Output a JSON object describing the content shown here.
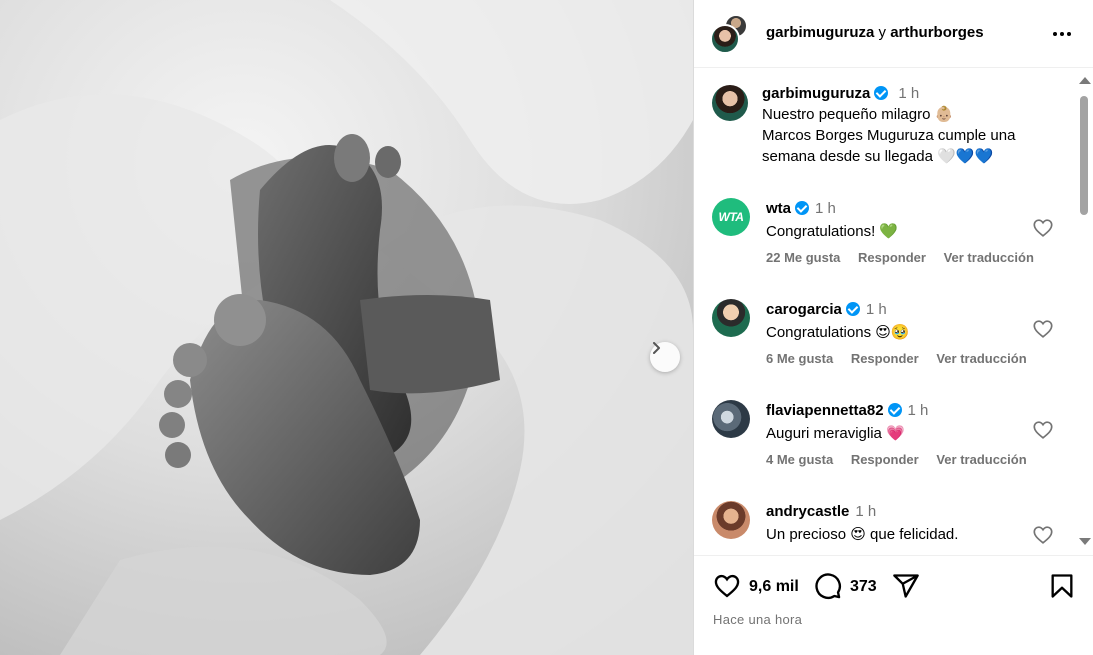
{
  "post": {
    "header": {
      "author": "garbimuguruza",
      "connector": "y",
      "coauthor": "arthurborges",
      "more_icon": "more-horizontal-icon"
    },
    "caption": {
      "username": "garbimuguruza",
      "verified": true,
      "time": "1 h",
      "line1": "Nuestro pequeño milagro",
      "line1_emoji": "👶🏼",
      "line2": "Marcos Borges Muguruza cumple una",
      "line3": "semana desde su llegada",
      "line3_emojis": "🤍💙💙"
    },
    "comments": [
      {
        "username": "wta",
        "verified": true,
        "time": "1 h",
        "text": "Congratulations!",
        "emoji": "💚",
        "likes": "22 Me gusta",
        "reply": "Responder",
        "translate": "Ver traducción",
        "avatar_text": "WTA"
      },
      {
        "username": "carogarcia",
        "verified": true,
        "time": "1 h",
        "text": "Congratulations",
        "emoji": "😍🥹",
        "likes": "6 Me gusta",
        "reply": "Responder",
        "translate": "Ver traducción"
      },
      {
        "username": "flaviapennetta82",
        "verified": true,
        "time": "1 h",
        "text": "Auguri meraviglia",
        "emoji": "💗",
        "likes": "4 Me gusta",
        "reply": "Responder",
        "translate": "Ver traducción"
      },
      {
        "username": "andrycastle",
        "verified": false,
        "time": "1 h",
        "text_before": "Un precioso",
        "emoji": "😍",
        "text_after": "que felicidad."
      }
    ],
    "actions": {
      "likes_count": "9,6 mil",
      "comments_count": "373",
      "timestamp": "Hace una hora",
      "icons": [
        "heart-icon",
        "comment-icon",
        "share-icon",
        "bookmark-icon"
      ]
    },
    "colors": {
      "verified_blue": "#0095f6",
      "meta_gray": "#737373",
      "wta_green": "#1fbc7d"
    }
  }
}
